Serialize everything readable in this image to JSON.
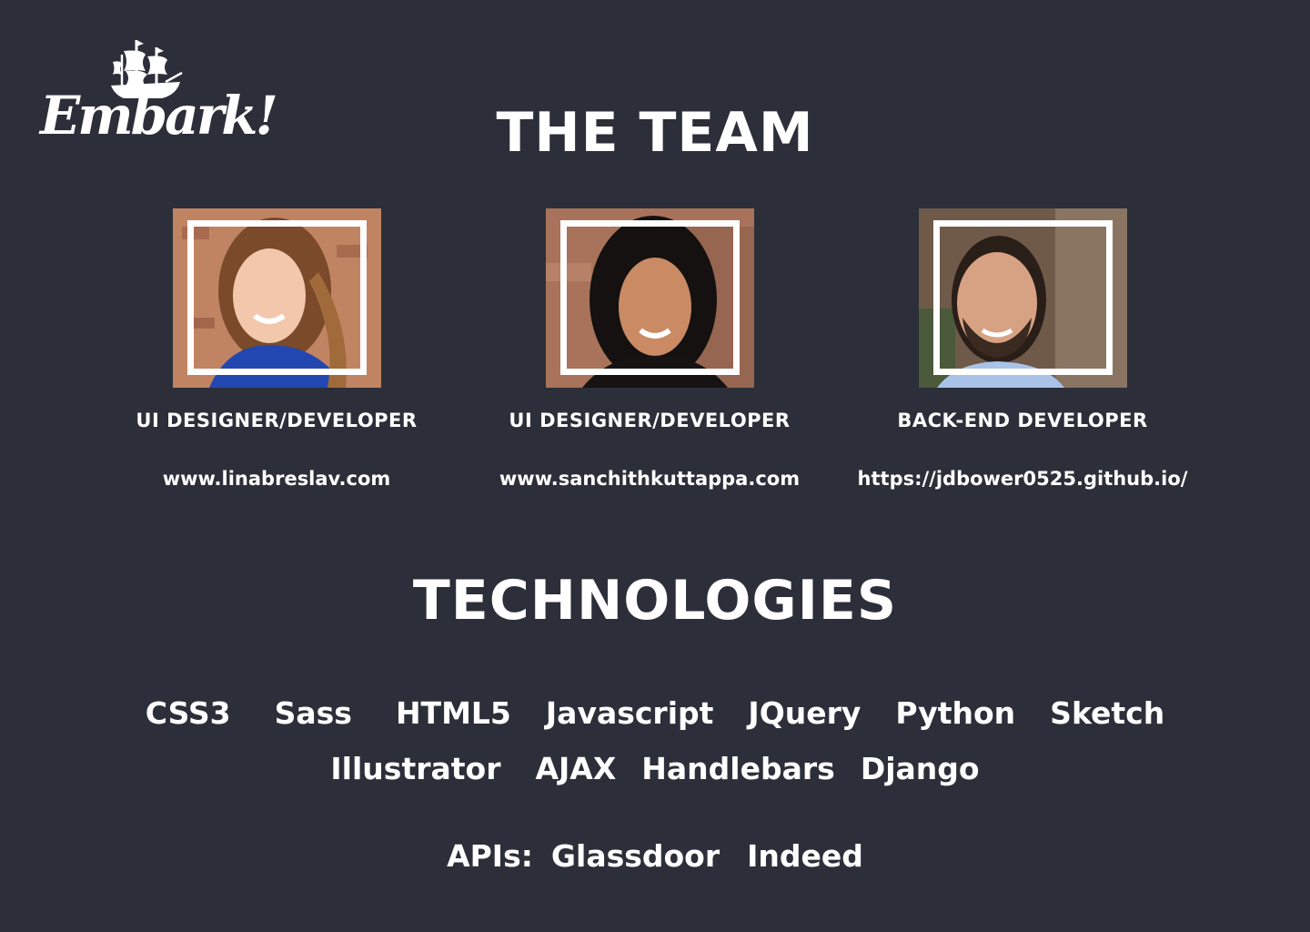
{
  "brand": {
    "logo_text": "Embark!",
    "logo_icon": "ship-icon"
  },
  "team": {
    "title": "THE TEAM",
    "members": [
      {
        "role": "UI DESIGNER/DEVELOPER",
        "website": "www.linabreslav.com",
        "photo": "avatar-woman-brown-hair"
      },
      {
        "role": "UI DESIGNER/DEVELOPER",
        "website": "www.sanchithkuttappa.com",
        "photo": "avatar-woman-black-hair"
      },
      {
        "role": "BACK-END DEVELOPER",
        "website": "https://jdbower0525.github.io/",
        "photo": "avatar-man-beard"
      }
    ]
  },
  "technologies": {
    "title": "TECHNOLOGIES",
    "row1": [
      "CSS3",
      "Sass",
      "HTML5",
      "Javascript",
      "JQuery",
      "Python",
      "Sketch"
    ],
    "row2": [
      "Illustrator",
      "AJAX",
      "Handlebars",
      "Django"
    ],
    "apis_label": "APIs:",
    "apis": [
      "Glassdoor",
      "Indeed"
    ]
  },
  "colors": {
    "background": "#2c2f39",
    "text": "#ffffff"
  }
}
